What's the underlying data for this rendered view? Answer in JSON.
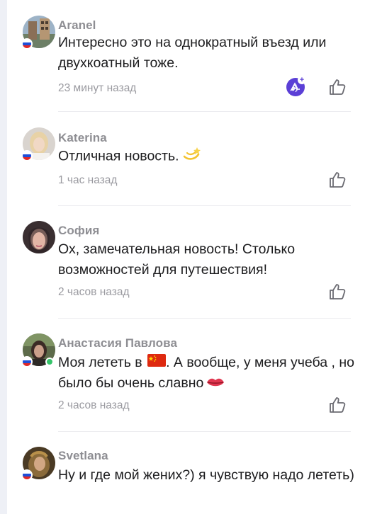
{
  "comments": [
    {
      "author": "Aranel",
      "text": "Интересно это на однократный въезд или двухкоатный тоже.",
      "time": "23 минут назад",
      "country": "ru",
      "has_reaction_button": true
    },
    {
      "author": "Katerina",
      "text": "Отличная новость.",
      "emoji": "dizzy-star",
      "time": "1 час назад",
      "country": "ru"
    },
    {
      "author": "София",
      "text": "Ох, замечательная новость! Столько возможностей для путешествия!",
      "time": "2 часов назад",
      "country": "none"
    },
    {
      "author": "Анастасия Павлова",
      "text_before_flag": "Моя лететь в",
      "flag_emoji": "china-flag",
      "text_after_flag": ". А вообще, у меня учеба , но было бы очень славно",
      "emoji": "kiss-lips",
      "time": "2 часов назад",
      "country": "ru",
      "online": true
    },
    {
      "author": "Svetlana",
      "text": "Ну и где мой жених?) я чувствую надо лететь)",
      "country": "ru"
    }
  ],
  "icons": {
    "like": "thumbs-up-outline-icon",
    "reaction": "add-reaction-icon",
    "country_flag": "russia-flag-icon"
  },
  "colors": {
    "author": "#8e8e93",
    "text": "#1c1c1e",
    "time": "#9a9aa0",
    "reaction": "#5b3fd6",
    "online": "#35c46a"
  }
}
